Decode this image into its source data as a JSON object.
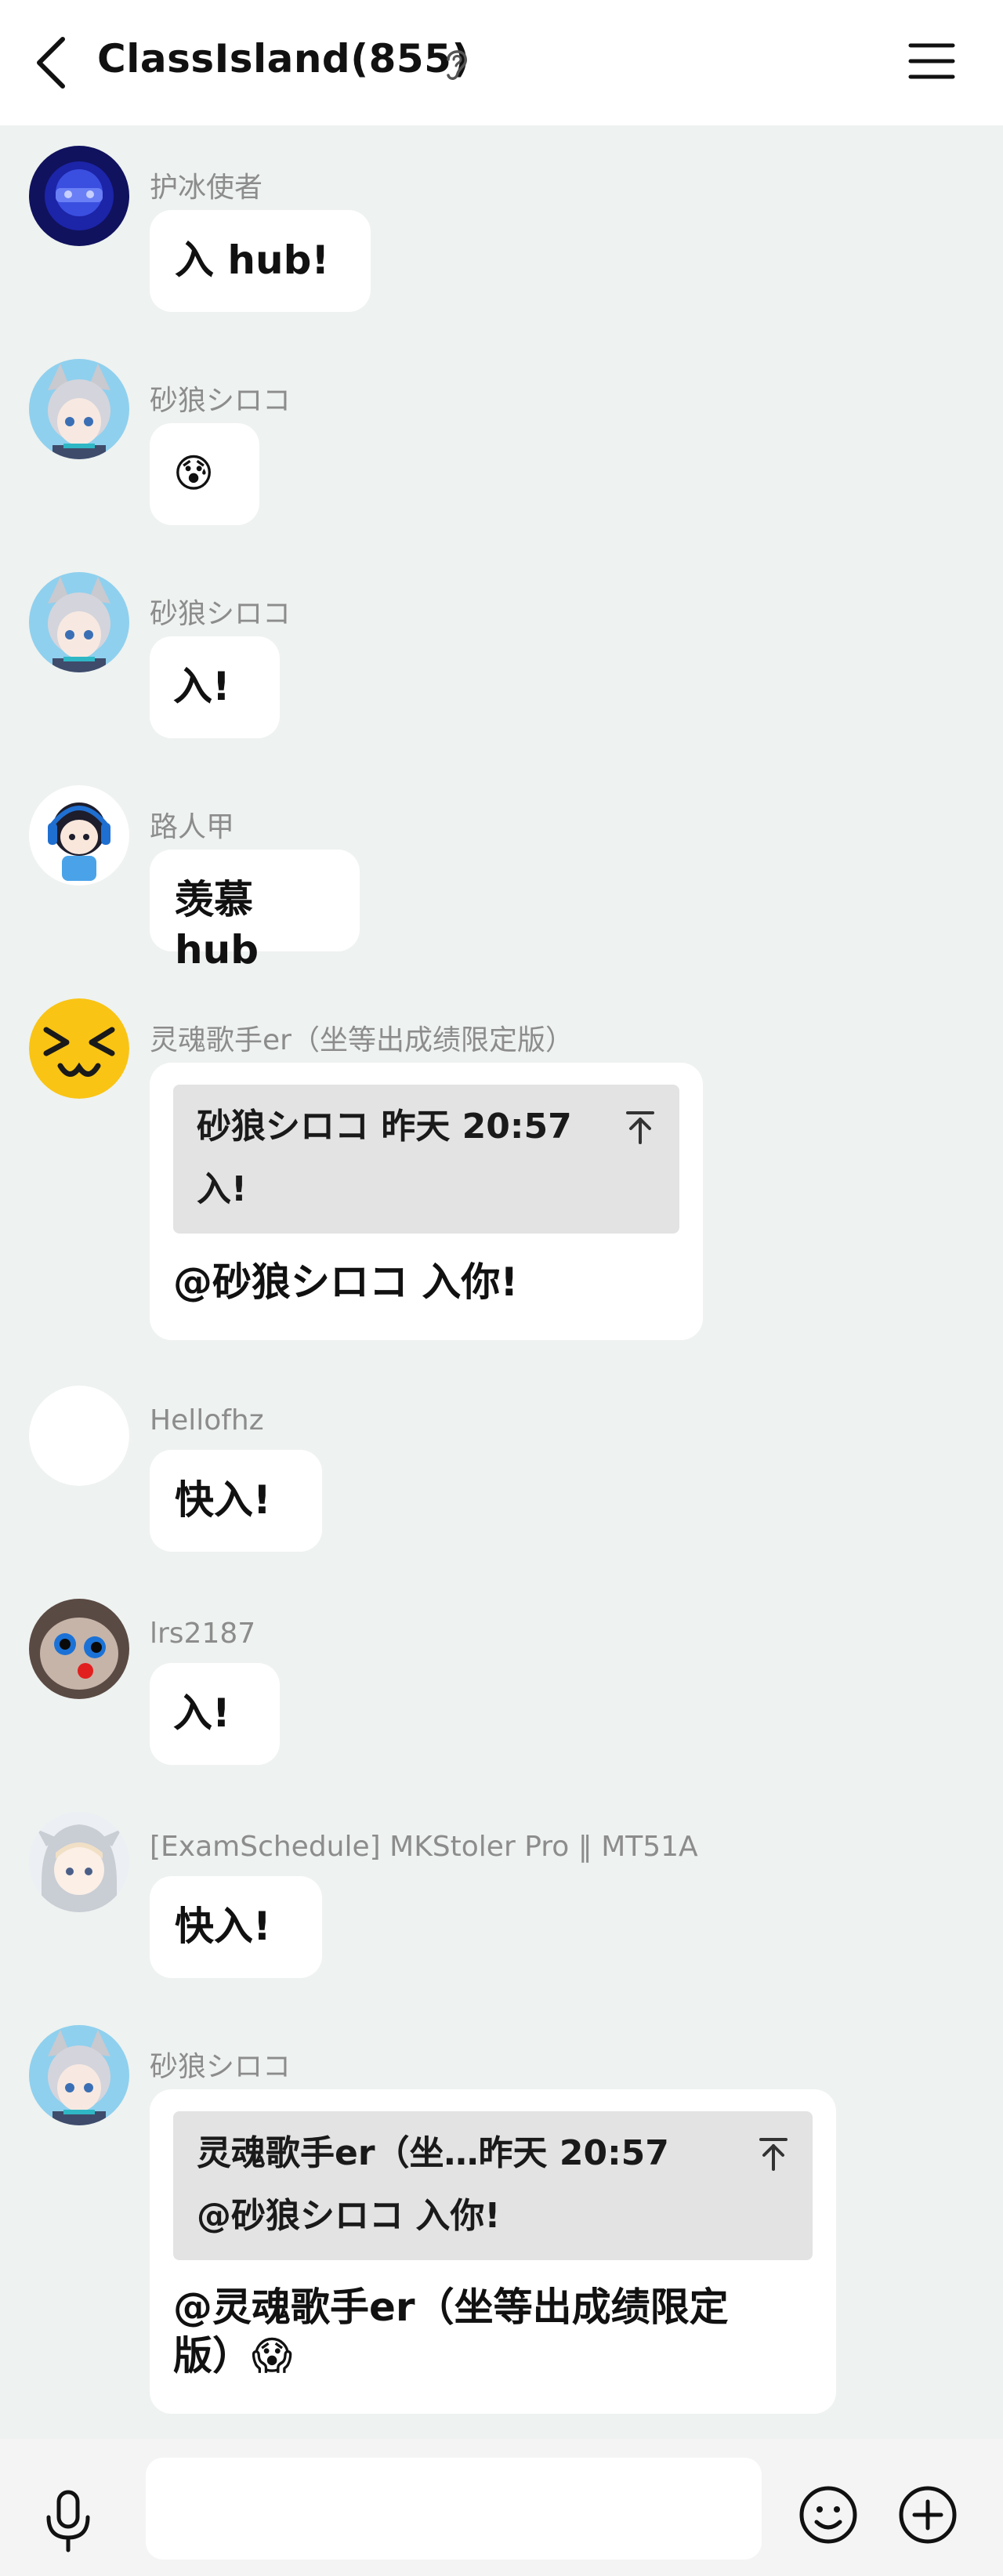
{
  "header": {
    "title": "ClassIsland(855)",
    "back_icon": "back-chevron-icon",
    "status_icon": "ear-icon",
    "menu_icon": "hamburger-menu-icon"
  },
  "messages": [
    {
      "sender": "护冰使者",
      "text": "入 hub!",
      "avatar": "dark-blue-avatar"
    },
    {
      "sender": "砂狼シロコ",
      "text": "😰",
      "avatar": "anime-girl-avatar"
    },
    {
      "sender": "砂狼シロコ",
      "text": "入!",
      "avatar": "anime-girl-avatar"
    },
    {
      "sender": "路人甲",
      "text": "羡慕hub",
      "avatar": "blue-headphone-avatar"
    },
    {
      "sender": "灵魂歌手er（坐等出成绩限定版）",
      "quote": {
        "header": "砂狼シロコ 昨天 20:57",
        "body": "入!"
      },
      "text": "@砂狼シロコ 入你!",
      "avatar": "squint-face-avatar"
    },
    {
      "sender": "Hellofhz",
      "text": "快入!",
      "avatar": "blank-white-avatar"
    },
    {
      "sender": "lrs2187",
      "text": "入!",
      "avatar": "cartoon-face-avatar"
    },
    {
      "sender": "[ExamSchedule] MKStoler Pro ‖ MT51A",
      "text": "快入!",
      "avatar": "white-hood-avatar"
    },
    {
      "sender": "砂狼シロコ",
      "quote": {
        "header": "灵魂歌手er（坐…昨天 20:57",
        "body": "@砂狼シロコ 入你!"
      },
      "text_line1": "@灵魂歌手er（坐等出成绩限定",
      "text_line2": "版）😱",
      "avatar": "anime-girl-avatar"
    }
  ],
  "input": {
    "placeholder": "",
    "mic_icon": "microphone-icon",
    "emoji_icon": "smiley-icon",
    "plus_icon": "plus-circle-icon"
  }
}
